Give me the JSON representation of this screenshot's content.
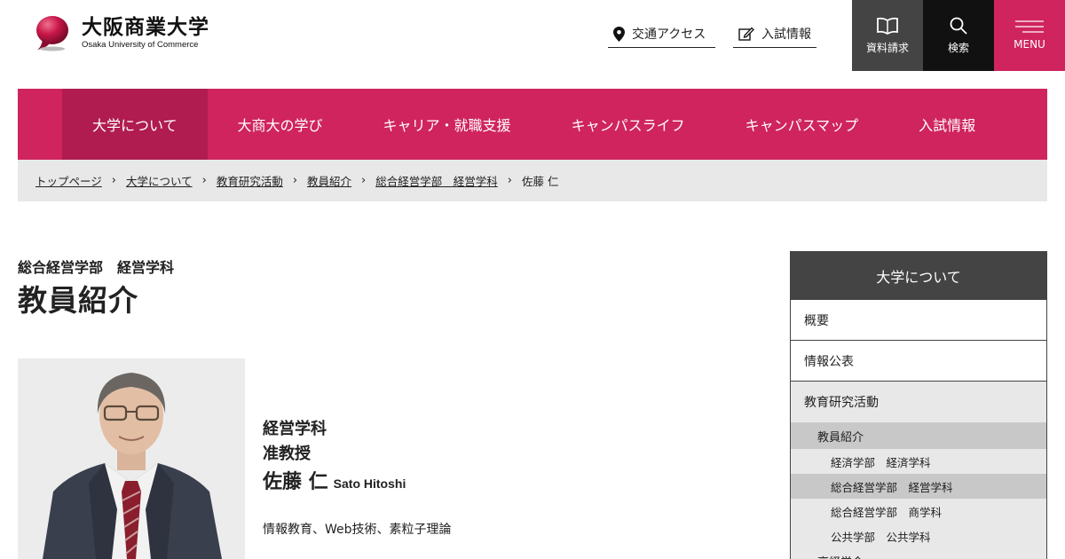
{
  "header": {
    "logo_jp": "大阪商業大学",
    "logo_en": "Osaka University of Commerce",
    "access_label": "交通アクセス",
    "admission_label": "入試情報",
    "brochure_label": "資料請求",
    "search_label": "検索",
    "menu_label": "MENU",
    "colors": {
      "brand": "#d0245e",
      "brochure_bg": "#444444",
      "search_bg": "#111111"
    }
  },
  "nav": {
    "items": [
      {
        "label": "大学について",
        "active": true
      },
      {
        "label": "大商大の学び"
      },
      {
        "label": "キャリア・就職支援"
      },
      {
        "label": "キャンパスライフ"
      },
      {
        "label": "キャンパスマップ"
      },
      {
        "label": "入試情報"
      }
    ]
  },
  "breadcrumb": {
    "items": [
      "トップページ",
      "大学について",
      "教育研究活動",
      "教員紹介",
      "総合経営学部　経営学科"
    ],
    "current": "佐藤 仁",
    "separator": "›"
  },
  "main": {
    "subtitle": "総合経営学部　経営学科",
    "title": "教員紹介",
    "department": "経営学科",
    "position": "准教授",
    "name": "佐藤 仁",
    "name_en": "Sato Hitoshi",
    "fields": "情報教育、Web技術、素粒子理論"
  },
  "sidebar": {
    "heading": "大学について",
    "items": [
      "概要",
      "情報公表",
      "教育研究活動"
    ],
    "sub_label": "教員紹介",
    "sub_items": [
      "経済学部　経済学科",
      "総合経営学部　経営学科",
      "総合経営学部　商学科",
      "公共学部　公共学科"
    ],
    "cut_item": "高経営会"
  }
}
